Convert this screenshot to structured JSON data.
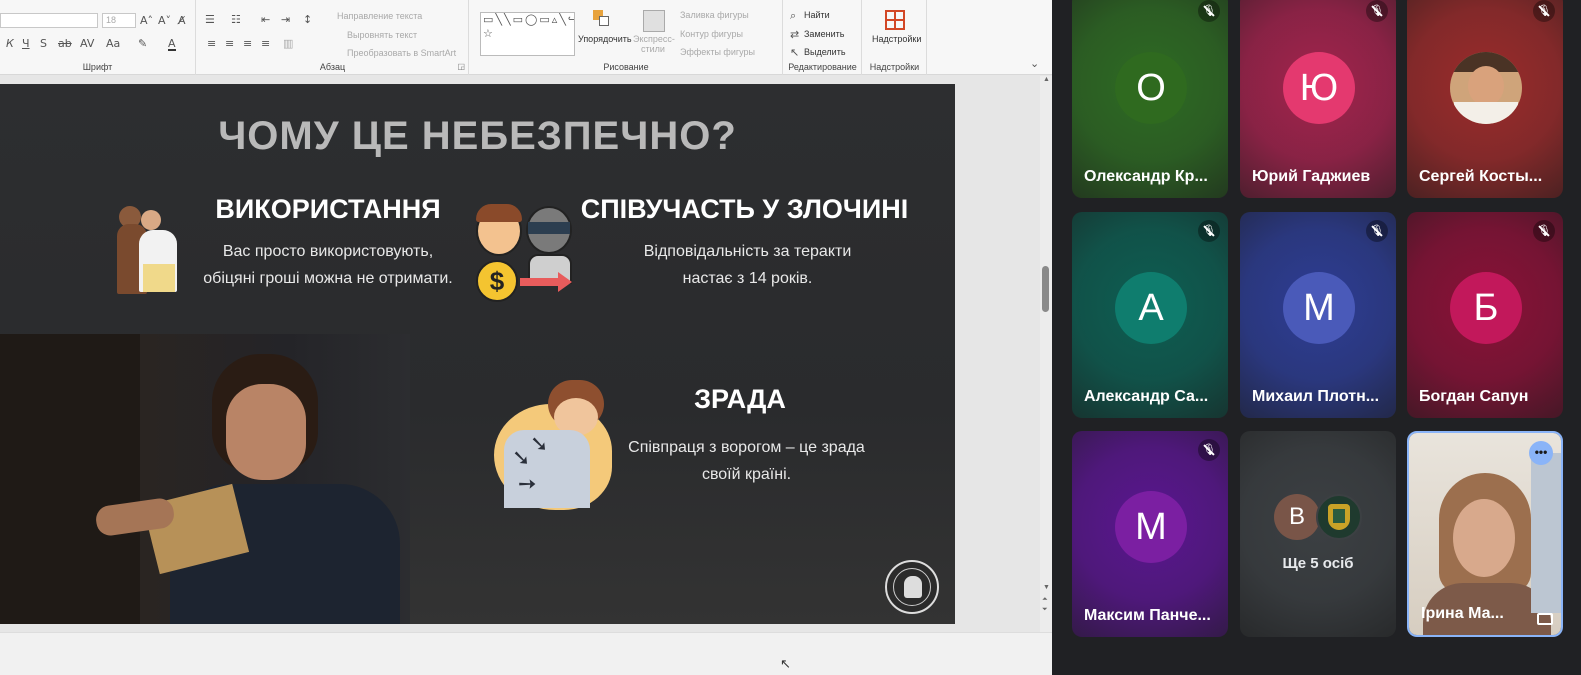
{
  "ribbon": {
    "groups": {
      "font": "Шрифт",
      "paragraph": "Абзац",
      "drawing": "Рисование",
      "editing": "Редактирование",
      "addins_group": "Надстройки"
    },
    "font_size_value": "18",
    "text_direction": "Направление текста",
    "align_text": "Выровнять текст",
    "smartart": "Преобразовать в SmartArt",
    "arrange": "Упорядочить",
    "express_styles": "Экспресс-стили",
    "shape_fill": "Заливка фигуры",
    "shape_outline": "Контур фигуры",
    "shape_effects": "Эффекты фигуры",
    "find": "Найти",
    "replace": "Заменить",
    "select": "Выделить",
    "addins": "Надстройки"
  },
  "slide": {
    "title": "ЧОМУ ЦЕ НЕБЕЗПЕЧНО?",
    "block1": {
      "heading": "ВИКОРИСТАННЯ",
      "line1": "Вас просто використовують,",
      "line2": "обіцяні гроші можна не отримати."
    },
    "block2": {
      "heading": "СПІВУЧАСТЬ У ЗЛОЧИНІ",
      "line1": "Відповідальність за теракти",
      "line2": "настає з 14 років."
    },
    "block3": {
      "heading": "ЗРАДА",
      "line1": "Співпраця з ворогом – це зрада",
      "line2": "своїй країні."
    }
  },
  "meet": {
    "participants": [
      {
        "initial": "О",
        "name": "Олександр Кр...",
        "muted": true,
        "bg": "#2e6b23",
        "avatar_color": "#2f6a1f"
      },
      {
        "initial": "Ю",
        "name": "Юрий Гаджиев",
        "muted": true,
        "bg": "#a3234d",
        "avatar_color": "#e4396f"
      },
      {
        "initial": "",
        "name": "Сергей Косты...",
        "muted": true,
        "bg": "#9b2b2b",
        "avatar_color": "#b98a5c"
      },
      {
        "initial": "А",
        "name": "Александр Са...",
        "muted": true,
        "bg": "#0d5e52",
        "avatar_color": "#0f7d6e"
      },
      {
        "initial": "М",
        "name": "Михаил Плотн...",
        "muted": true,
        "bg": "#2d3d94",
        "avatar_color": "#4a5ab9"
      },
      {
        "initial": "Б",
        "name": "Богдан Сапун",
        "muted": true,
        "bg": "#8a1137",
        "avatar_color": "#c2185b"
      },
      {
        "initial": "М",
        "name": "Максим Панче...",
        "muted": true,
        "bg": "#5a1690",
        "avatar_color": "#7b1fa2"
      },
      {
        "initial": "В",
        "name": "",
        "muted": false,
        "bg": "#3c4043",
        "avatar_color": "#795548"
      },
      {
        "initial": "",
        "name": "Ірина Ма...",
        "muted": false,
        "bg": "#d8cfc4",
        "avatar_color": "#a07868"
      }
    ],
    "more_label": "Ще 5 осіб"
  }
}
